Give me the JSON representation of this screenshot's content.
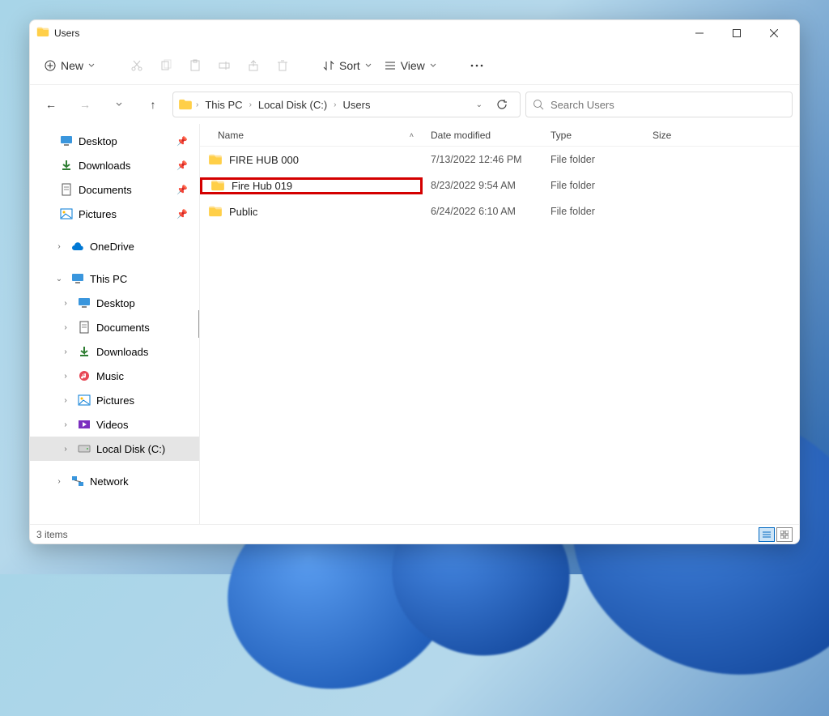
{
  "title": "Users",
  "toolbar": {
    "new": "New",
    "sort": "Sort",
    "view": "View"
  },
  "breadcrumbs": [
    "This PC",
    "Local Disk (C:)",
    "Users"
  ],
  "search_placeholder": "Search Users",
  "quick_access": [
    {
      "label": "Desktop"
    },
    {
      "label": "Downloads"
    },
    {
      "label": "Documents"
    },
    {
      "label": "Pictures"
    }
  ],
  "onedrive": "OneDrive",
  "thispc": {
    "label": "This PC",
    "children": [
      {
        "label": "Desktop"
      },
      {
        "label": "Documents"
      },
      {
        "label": "Downloads"
      },
      {
        "label": "Music"
      },
      {
        "label": "Pictures"
      },
      {
        "label": "Videos"
      },
      {
        "label": "Local Disk (C:)"
      }
    ]
  },
  "network": "Network",
  "columns": {
    "name": "Name",
    "date": "Date modified",
    "type": "Type",
    "size": "Size"
  },
  "rows": [
    {
      "name": "FIRE HUB 000",
      "date": "7/13/2022 12:46 PM",
      "type": "File folder",
      "size": "",
      "highlight": false
    },
    {
      "name": "Fire Hub 019",
      "date": "8/23/2022 9:54 AM",
      "type": "File folder",
      "size": "",
      "highlight": true
    },
    {
      "name": "Public",
      "date": "6/24/2022 6:10 AM",
      "type": "File folder",
      "size": "",
      "highlight": false
    }
  ],
  "status": "3 items"
}
